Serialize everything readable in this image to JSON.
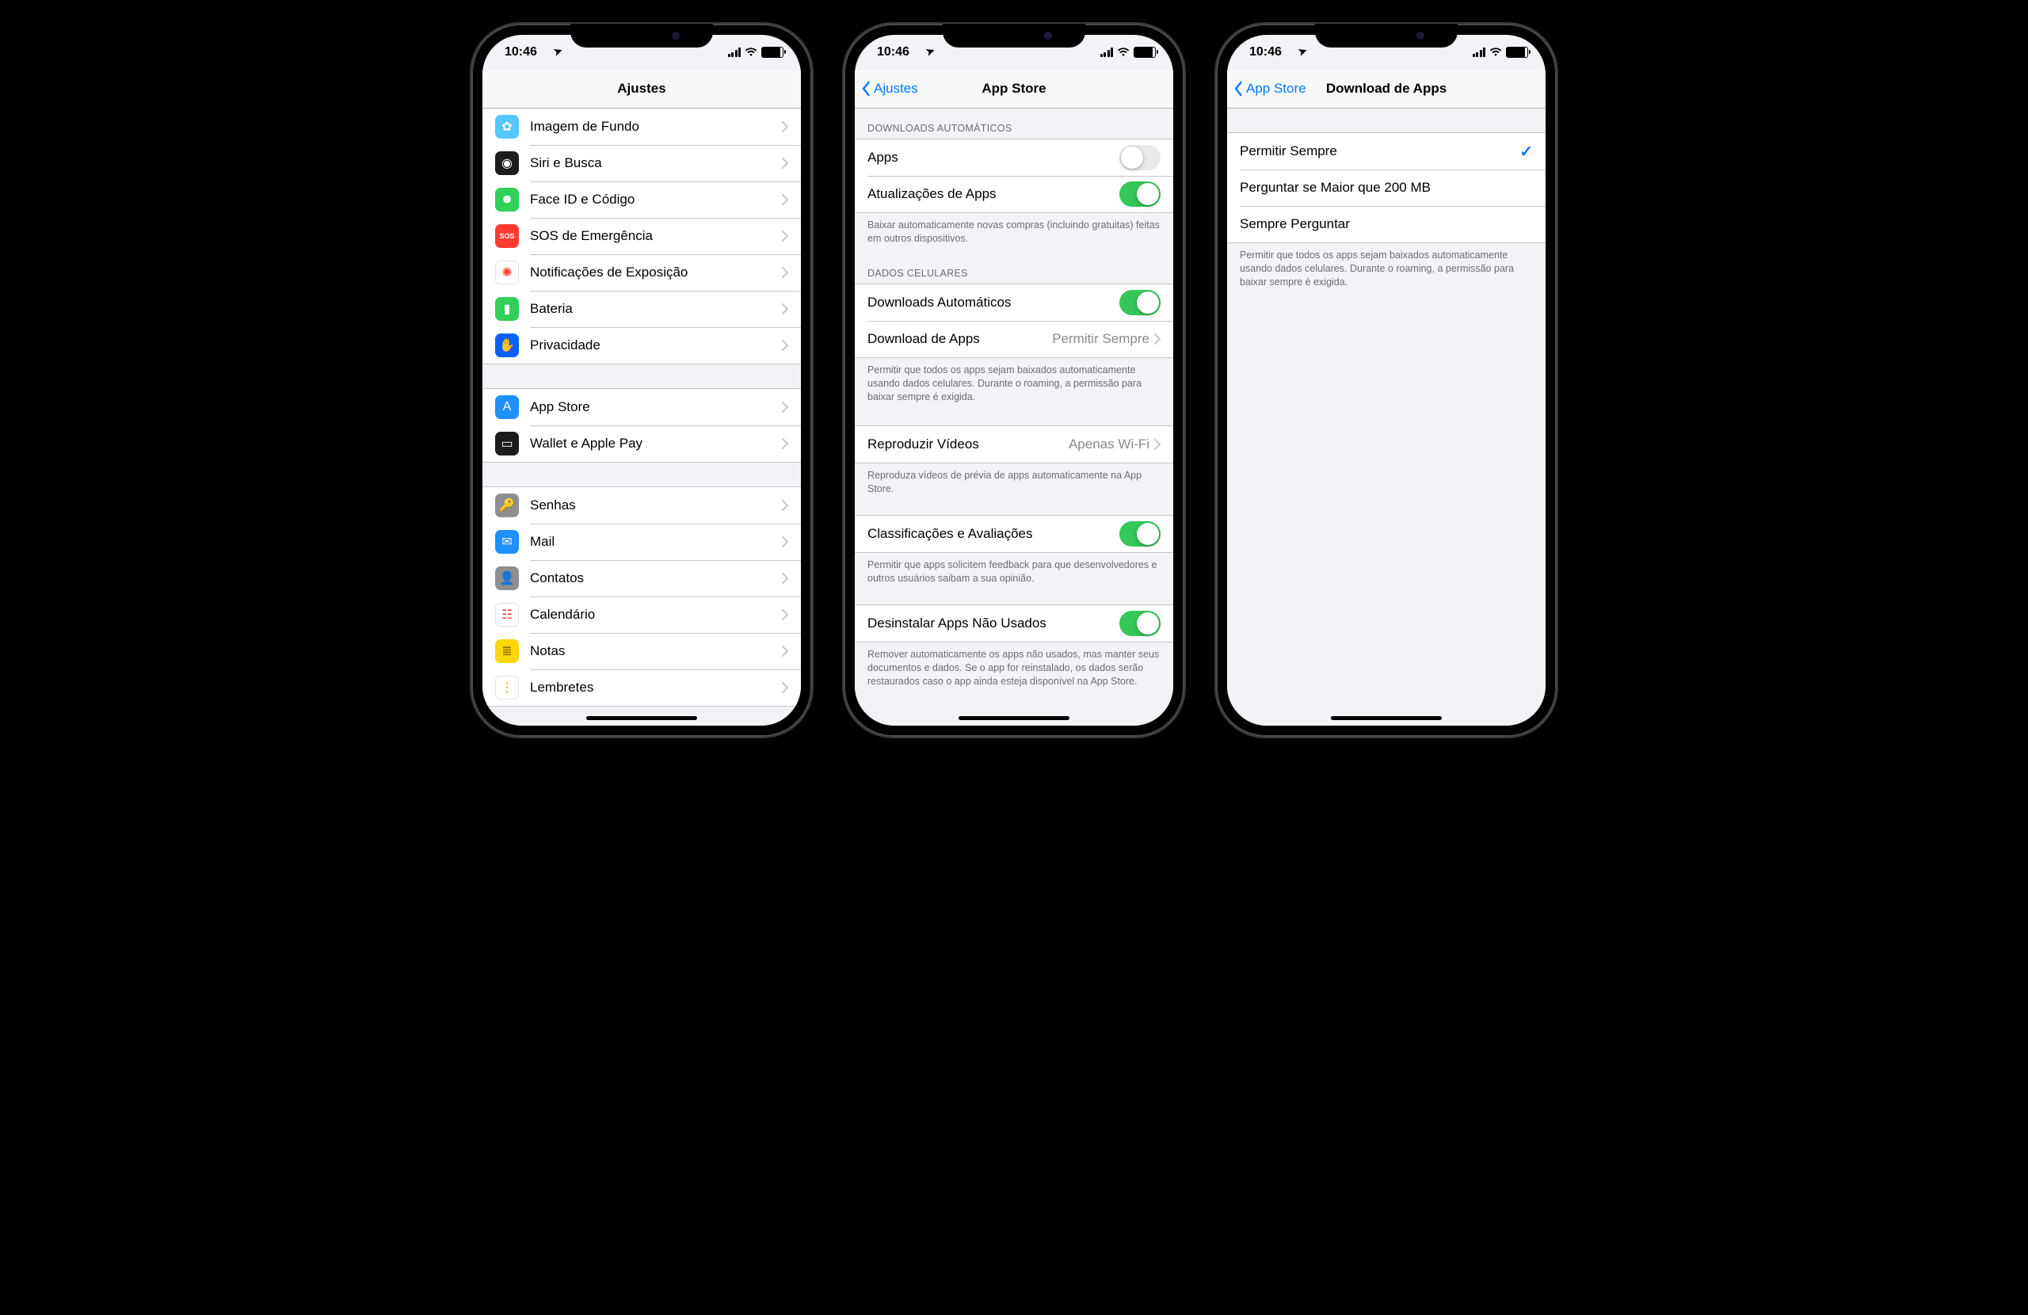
{
  "status": {
    "time": "10:46",
    "location_glyph": "➤"
  },
  "phone1": {
    "nav_title": "Ajustes",
    "groups": [
      {
        "items": [
          {
            "key": "wallpaper",
            "label": "Imagem de Fundo",
            "icon_bg": "#54c7fc",
            "icon_glyph": "✿"
          },
          {
            "key": "siri",
            "label": "Siri e Busca",
            "icon_bg": "#1c1c1e",
            "icon_glyph": "◉"
          },
          {
            "key": "faceid",
            "label": "Face ID e Código",
            "icon_bg": "#30d158",
            "icon_glyph": "☻"
          },
          {
            "key": "sos",
            "label": "SOS de Emergência",
            "icon_bg": "#ff3b30",
            "icon_glyph": "SOS",
            "icon_text": true
          },
          {
            "key": "exposure",
            "label": "Notificações de Exposição",
            "icon_bg": "#ffffff",
            "icon_glyph": "✺",
            "icon_fg": "#ff3b30",
            "icon_border": true
          },
          {
            "key": "battery",
            "label": "Bateria",
            "icon_bg": "#30d158",
            "icon_glyph": "▮"
          },
          {
            "key": "privacy",
            "label": "Privacidade",
            "icon_bg": "#0a60ff",
            "icon_glyph": "✋"
          }
        ]
      },
      {
        "items": [
          {
            "key": "appstore",
            "label": "App Store",
            "icon_bg": "#1e90ff",
            "icon_glyph": "A"
          },
          {
            "key": "wallet",
            "label": "Wallet e Apple Pay",
            "icon_bg": "#1c1c1e",
            "icon_glyph": "▭"
          }
        ]
      },
      {
        "items": [
          {
            "key": "passwords",
            "label": "Senhas",
            "icon_bg": "#8e8e93",
            "icon_glyph": "🔑"
          },
          {
            "key": "mail",
            "label": "Mail",
            "icon_bg": "#1e90ff",
            "icon_glyph": "✉"
          },
          {
            "key": "contacts",
            "label": "Contatos",
            "icon_bg": "#8e8e93",
            "icon_glyph": "👤"
          },
          {
            "key": "calendar",
            "label": "Calendário",
            "icon_bg": "#ffffff",
            "icon_glyph": "☷",
            "icon_fg": "#ff3b30",
            "icon_border": true
          },
          {
            "key": "notes",
            "label": "Notas",
            "icon_bg": "#ffd60a",
            "icon_glyph": "≣",
            "icon_fg": "#8a6d00"
          },
          {
            "key": "reminders",
            "label": "Lembretes",
            "icon_bg": "#ffffff",
            "icon_glyph": "⋮",
            "icon_fg": "#ff9500",
            "icon_border": true
          }
        ]
      }
    ]
  },
  "phone2": {
    "back_label": "Ajustes",
    "nav_title": "App Store",
    "section_auto_header": "DOWNLOADS AUTOMÁTICOS",
    "row_apps": "Apps",
    "row_updates": "Atualizações de Apps",
    "footer_auto": "Baixar automaticamente novas compras (incluindo gratuitas) feitas em outros dispositivos.",
    "section_cell_header": "DADOS CELULARES",
    "row_auto_dl": "Downloads Automáticos",
    "row_app_dl": "Download de Apps",
    "row_app_dl_value": "Permitir Sempre",
    "footer_cell": "Permitir que todos os apps sejam baixados automaticamente usando dados celulares. Durante o roaming, a permissão para baixar sempre é exigida.",
    "row_videos": "Reproduzir Vídeos",
    "row_videos_value": "Apenas Wi-Fi",
    "footer_videos": "Reproduza vídeos de prévia de apps automaticamente na App Store.",
    "row_ratings": "Classificações e Avaliações",
    "footer_ratings": "Permitir que apps solicitem feedback para que desenvolvedores e outros usuários saibam a sua opinião.",
    "row_offload": "Desinstalar Apps Não Usados",
    "footer_offload": "Remover automaticamente os apps não usados, mas manter seus documentos e dados. Se o app for reinstalado, os dados serão restaurados caso o app ainda esteja disponível na App Store.",
    "toggles": {
      "apps": false,
      "updates": true,
      "auto_dl": true,
      "ratings": true,
      "offload": true
    }
  },
  "phone3": {
    "back_label": "App Store",
    "nav_title": "Download de Apps",
    "options": [
      {
        "key": "always",
        "label": "Permitir Sempre",
        "selected": true
      },
      {
        "key": "ask200",
        "label": "Perguntar se Maior que 200 MB",
        "selected": false
      },
      {
        "key": "askalways",
        "label": "Sempre Perguntar",
        "selected": false
      }
    ],
    "footer": "Permitir que todos os apps sejam baixados automaticamente usando dados celulares. Durante o roaming, a permissão para baixar sempre é exigida."
  }
}
